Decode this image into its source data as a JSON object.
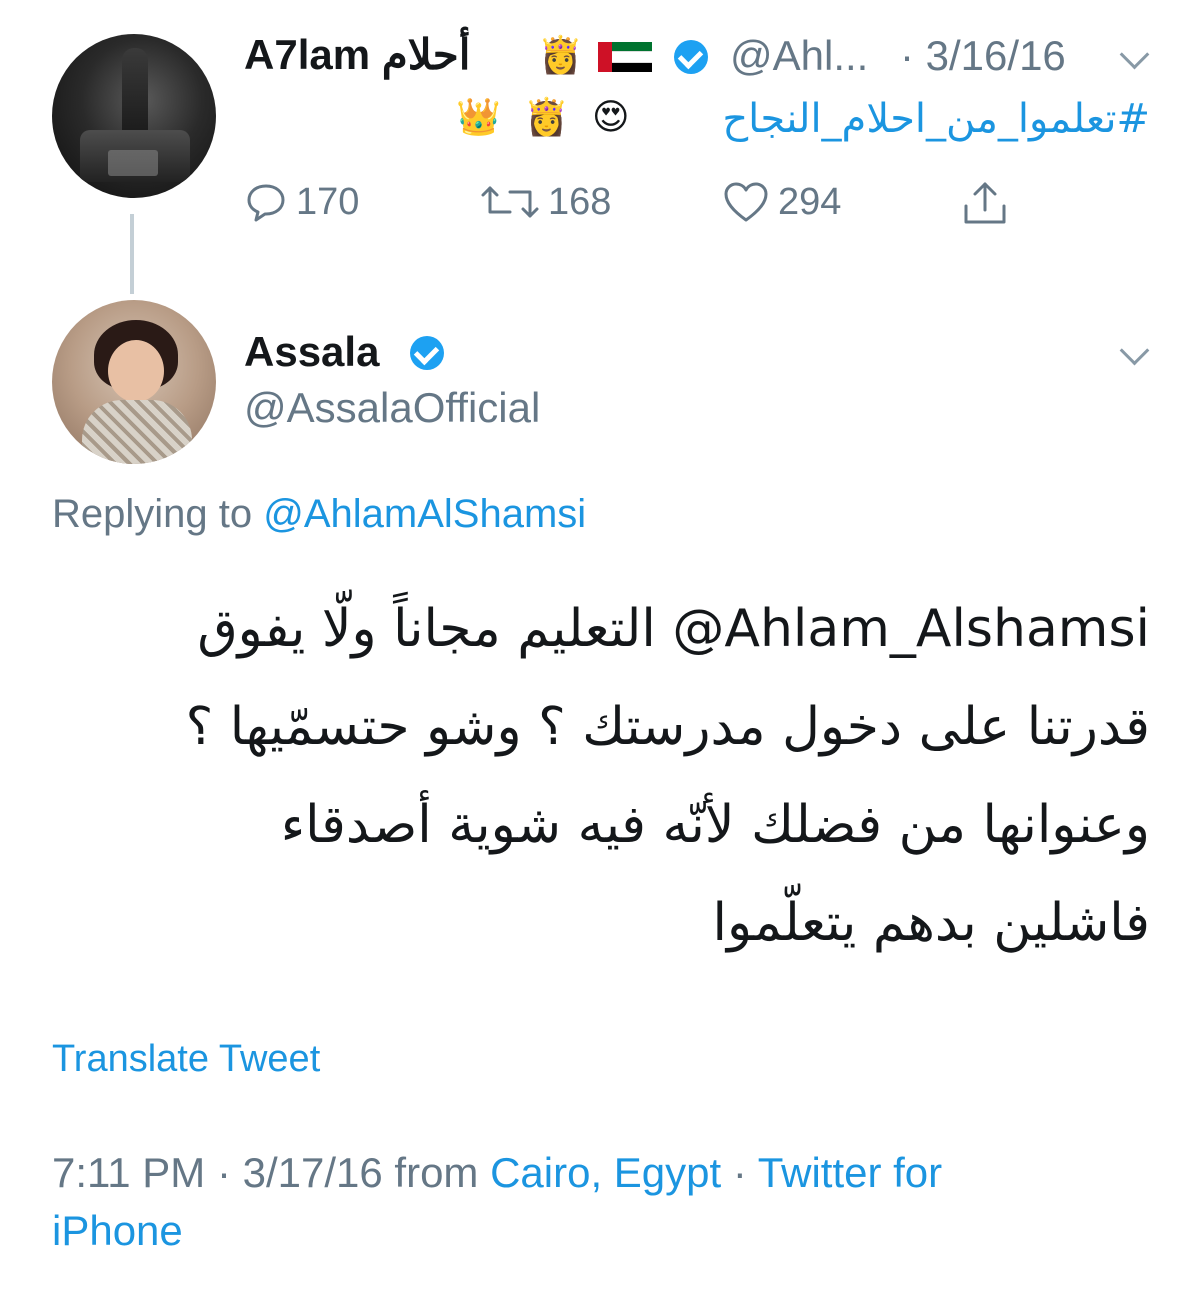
{
  "original_tweet": {
    "display_name": "A7lam أحلام",
    "emojis": [
      "👸",
      "🇦🇪"
    ],
    "handle": "@Ahl...",
    "date": "· 3/16/16",
    "hashtag": "#تعلموا_من_احلام_النجاح",
    "trailing_emojis": [
      "😍",
      "👸",
      "👑"
    ],
    "actions": {
      "replies": "170",
      "retweets": "168",
      "likes": "294"
    },
    "icons": [
      "reply-icon",
      "retweet-icon",
      "like-icon",
      "share-icon",
      "chevron-down-icon",
      "verified-badge-icon"
    ]
  },
  "reply_tweet": {
    "display_name": "Assala",
    "handle": "@AssalaOfficial",
    "replying_prefix": "Replying to ",
    "replying_to": "@AhlamAlShamsi",
    "text_lines": [
      "Ahlam_Alshamsi@ التعليم مجاناً ولّا يفوق",
      "قدرتنا على دخول مدرستك ؟ وشو حتسمّيها ؟",
      "وعنوانها من فضلك لأنّه فيه شوية أصدقاء",
      "فاشلين بدهم يتعلّموا"
    ],
    "translate_label": "Translate Tweet",
    "meta": {
      "time_date": "7:11 PM · 3/17/16 from ",
      "location": "Cairo, Egypt",
      "separator": " · ",
      "source_line1": "Twitter for",
      "source_line2": "iPhone"
    }
  },
  "colors": {
    "link_blue": "#1b95e0",
    "verified_blue": "#1da1f2",
    "muted_gray": "#657786",
    "thread_line": "#c4cfd6"
  }
}
